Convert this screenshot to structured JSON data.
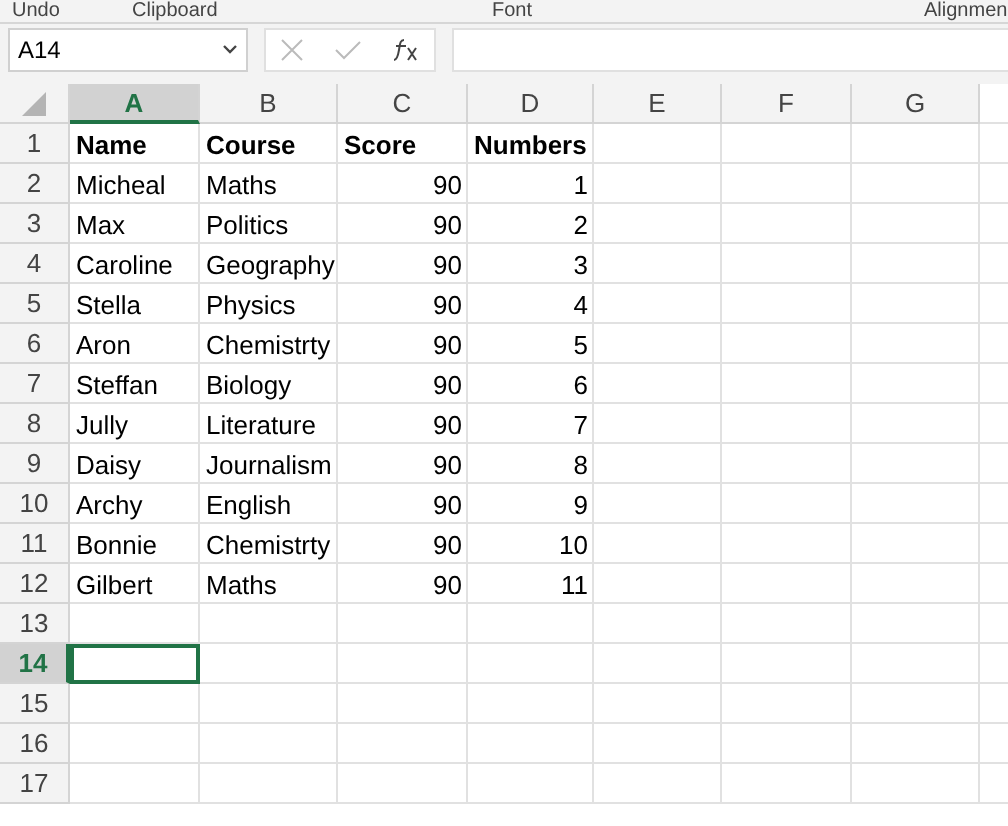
{
  "ribbon_groups": [
    "Undo",
    "Clipboard",
    "Font",
    "Alignmen"
  ],
  "name_box": {
    "value": "A14"
  },
  "columns": [
    {
      "label": "A",
      "kind": "text",
      "selected": true
    },
    {
      "label": "B",
      "kind": "text",
      "selected": false
    },
    {
      "label": "C",
      "kind": "number",
      "selected": false
    },
    {
      "label": "D",
      "kind": "number",
      "selected": false
    },
    {
      "label": "E",
      "kind": "text",
      "selected": false
    },
    {
      "label": "F",
      "kind": "text",
      "selected": false
    },
    {
      "label": "G",
      "kind": "text",
      "selected": false
    }
  ],
  "rows": [
    {
      "label": "1",
      "kind": "header",
      "selected": false,
      "cells": [
        "Name",
        "Course",
        "Score",
        "Numbers"
      ]
    },
    {
      "label": "2",
      "kind": "data",
      "selected": false,
      "cells": [
        "Micheal",
        "Maths",
        "90",
        "1"
      ]
    },
    {
      "label": "3",
      "kind": "data",
      "selected": false,
      "cells": [
        "Max",
        "Politics",
        "90",
        "2"
      ]
    },
    {
      "label": "4",
      "kind": "data",
      "selected": false,
      "cells": [
        "Caroline",
        "Geography",
        "90",
        "3"
      ]
    },
    {
      "label": "5",
      "kind": "data",
      "selected": false,
      "cells": [
        "Stella",
        "Physics",
        "90",
        "4"
      ]
    },
    {
      "label": "6",
      "kind": "data",
      "selected": false,
      "cells": [
        "Aron",
        "Chemistrty",
        "90",
        "5"
      ]
    },
    {
      "label": "7",
      "kind": "data",
      "selected": false,
      "cells": [
        "Steffan",
        "Biology",
        "90",
        "6"
      ]
    },
    {
      "label": "8",
      "kind": "data",
      "selected": false,
      "cells": [
        "Jully",
        "Literature",
        "90",
        "7"
      ]
    },
    {
      "label": "9",
      "kind": "data",
      "selected": false,
      "cells": [
        "Daisy",
        "Journalism",
        "90",
        "8"
      ]
    },
    {
      "label": "10",
      "kind": "data",
      "selected": false,
      "cells": [
        "Archy",
        "English",
        "90",
        "9"
      ]
    },
    {
      "label": "11",
      "kind": "data",
      "selected": false,
      "cells": [
        "Bonnie",
        "Chemistrty",
        "90",
        "10"
      ]
    },
    {
      "label": "12",
      "kind": "data",
      "selected": false,
      "cells": [
        "Gilbert",
        "Maths",
        "90",
        "11"
      ]
    },
    {
      "label": "13",
      "kind": "data",
      "selected": false,
      "cells": []
    },
    {
      "label": "14",
      "kind": "data",
      "selected": true,
      "cells": []
    },
    {
      "label": "15",
      "kind": "data",
      "selected": false,
      "cells": []
    },
    {
      "label": "16",
      "kind": "data",
      "selected": false,
      "cells": []
    },
    {
      "label": "17",
      "kind": "data",
      "selected": false,
      "cells": []
    }
  ]
}
